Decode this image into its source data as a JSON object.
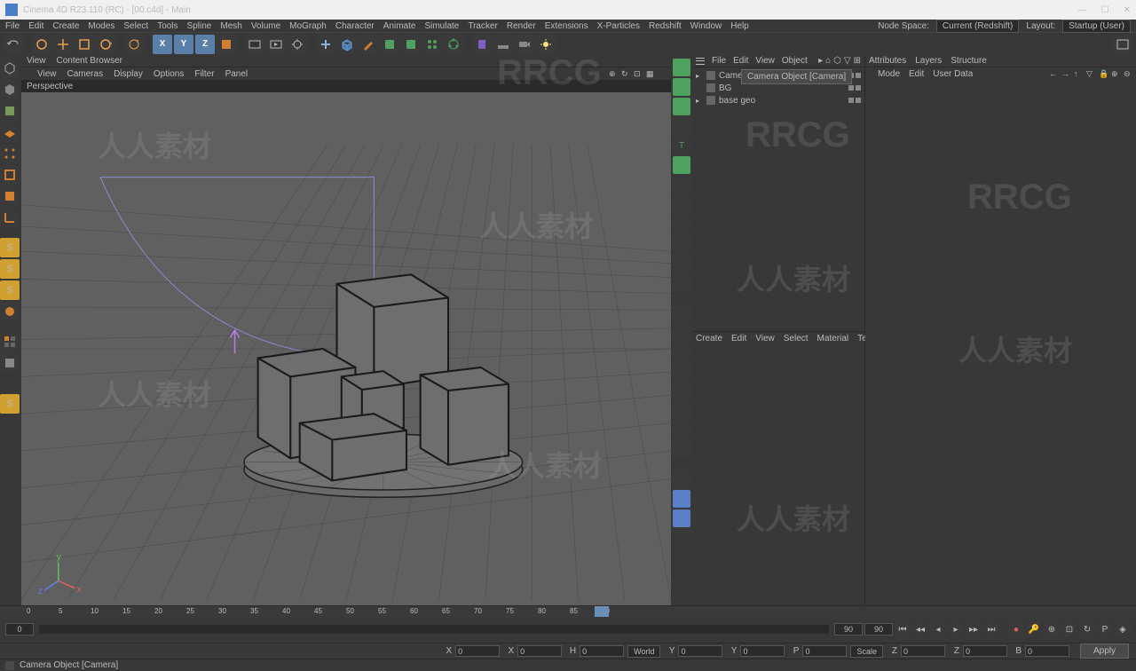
{
  "title": "Cinema 4D R23.110 (RC) - [00.c4d] - Main",
  "menubar": [
    "File",
    "Edit",
    "Create",
    "Modes",
    "Select",
    "Tools",
    "Spline",
    "Mesh",
    "Volume",
    "MoGraph",
    "Character",
    "Animate",
    "Simulate",
    "Tracker",
    "Render",
    "Extensions",
    "X-Particles",
    "Redshift",
    "Window",
    "Help"
  ],
  "node_space_label": "Node Space:",
  "node_space_value": "Current (Redshift)",
  "layout_label": "Layout:",
  "layout_value": "Startup (User)",
  "vp_tabs": [
    "View",
    "Content Browser"
  ],
  "vp_menu": [
    "View",
    "Cameras",
    "Display",
    "Options",
    "Filter",
    "Panel"
  ],
  "vp_label": "Perspective",
  "obj_menu": [
    "File",
    "Edit",
    "View",
    "Object"
  ],
  "objects": [
    {
      "name": "Camera",
      "icon": "camera-icon"
    },
    {
      "name": "BG",
      "icon": "null-icon"
    },
    {
      "name": "base geo",
      "icon": "null-icon"
    }
  ],
  "tooltip": "Camera Object [Camera]",
  "attr_tabs": [
    "Attributes",
    "Layers",
    "Structure"
  ],
  "attr_menu": [
    "Mode",
    "Edit",
    "User Data"
  ],
  "mat_menu": [
    "Create",
    "Edit",
    "View",
    "Select",
    "Material",
    "Texture"
  ],
  "timeline": {
    "start": 0,
    "end": 90,
    "current": 90,
    "ticks": [
      0,
      5,
      10,
      15,
      20,
      25,
      30,
      35,
      40,
      45,
      50,
      55,
      60,
      65,
      70,
      75,
      80,
      85,
      90
    ]
  },
  "coords": {
    "x": "0",
    "y": "0",
    "z": "0",
    "sx": "0",
    "sy": "0",
    "sz": "0",
    "h": "0",
    "p": "0",
    "b": "0",
    "world": "World",
    "scale": "Scale",
    "apply": "Apply"
  },
  "status": "Camera Object [Camera]",
  "watermarks": [
    "RRCG",
    "人人素材"
  ]
}
